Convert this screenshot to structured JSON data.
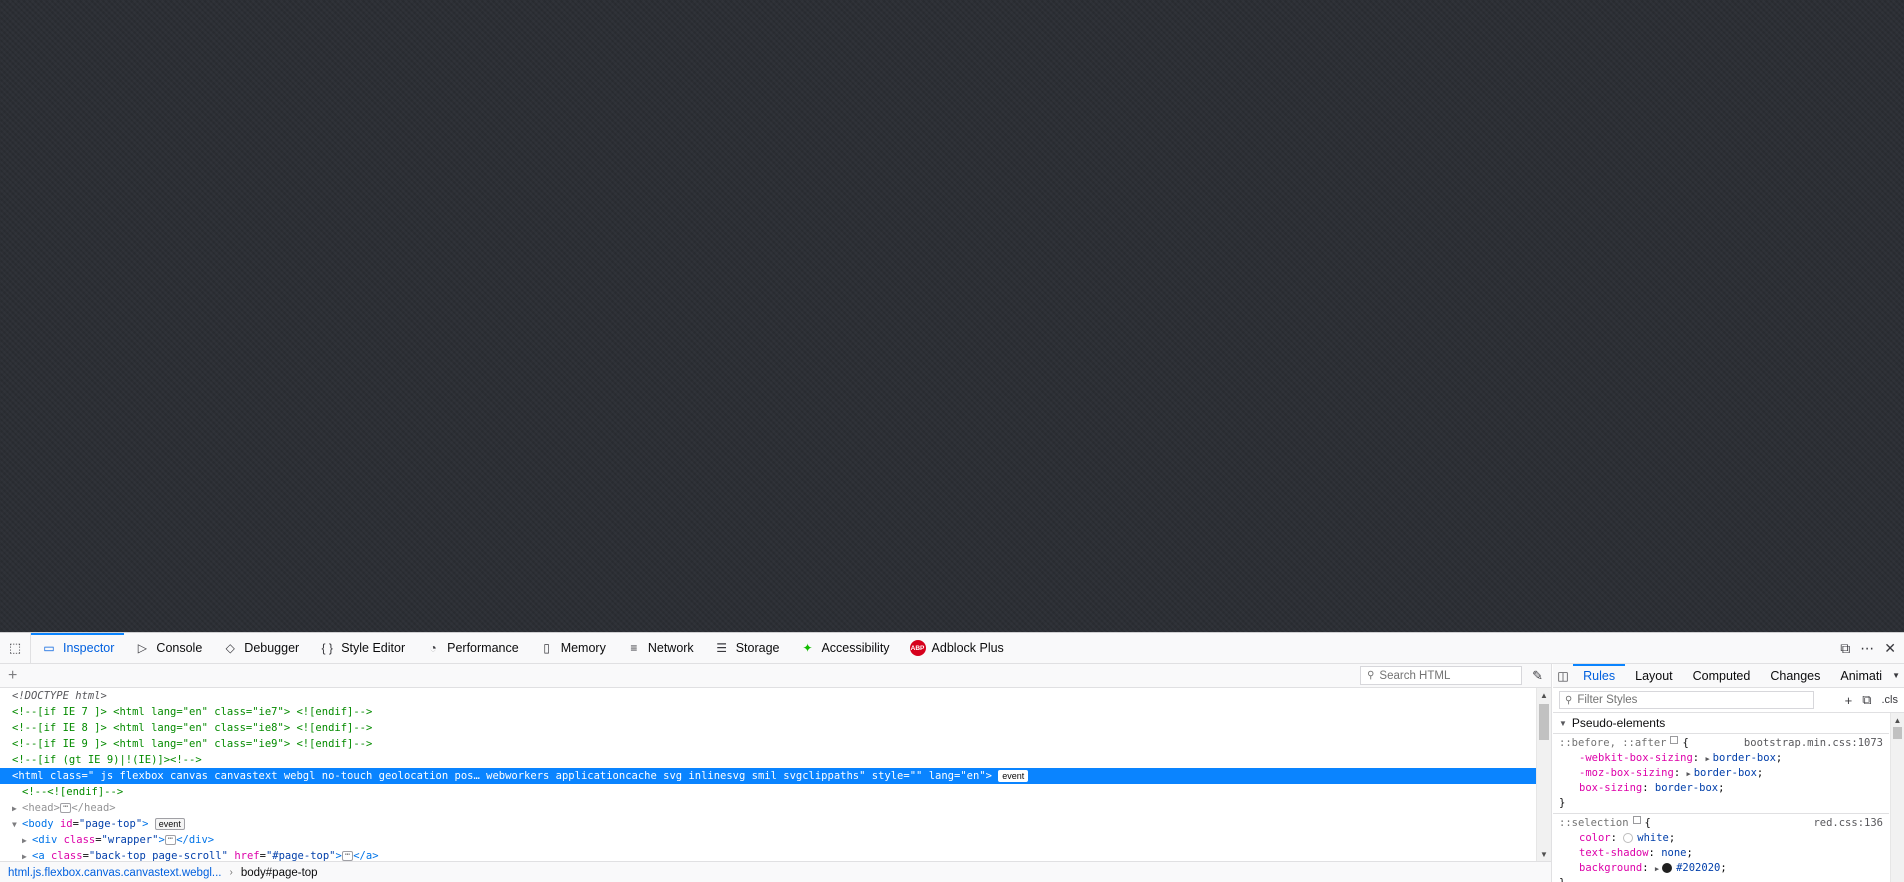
{
  "toolbar": {
    "tabs": [
      {
        "label": "Inspector",
        "icon": "inspector-icon"
      },
      {
        "label": "Console",
        "icon": "console-icon"
      },
      {
        "label": "Debugger",
        "icon": "debugger-icon"
      },
      {
        "label": "Style Editor",
        "icon": "braces-icon"
      },
      {
        "label": "Performance",
        "icon": "performance-icon"
      },
      {
        "label": "Memory",
        "icon": "memory-icon"
      },
      {
        "label": "Network",
        "icon": "network-icon"
      },
      {
        "label": "Storage",
        "icon": "storage-icon"
      },
      {
        "label": "Accessibility",
        "icon": "accessibility-icon"
      },
      {
        "label": "Adblock Plus",
        "icon": "abp-icon"
      }
    ],
    "abp_badge": "ABP"
  },
  "markup": {
    "search_placeholder": "Search HTML",
    "lines": {
      "doctype": "<!DOCTYPE html>",
      "ie7": "<!--[if IE 7 ]> <html lang=\"en\" class=\"ie7\"> <![endif]-->",
      "ie8": "<!--[if IE 8 ]> <html lang=\"en\" class=\"ie8\"> <![endif]-->",
      "ie9": "<!--[if IE 9 ]> <html lang=\"en\" class=\"ie9\"> <![endif]-->",
      "gtie9": "<!--[if (gt IE 9)|!(IE)]><!-->",
      "html_class_value": "\" js flexbox canvas canvastext webgl no-touch geolocation pos… webworkers applicationcache svg inlinesvg smil svgclippaths\"",
      "html_style_value": "\"\"",
      "html_lang_value": "\"en\"",
      "endif": "<!--<![endif]-->",
      "body_id_value": "\"page-top\"",
      "div_class_value": "\"wrapper\"",
      "a_class_value": "\"back-top page-scroll\"",
      "a_href_value": "\"#page-top\""
    },
    "event_badge": "event",
    "breadcrumbs": [
      "html.js.flexbox.canvas.canvastext.webgl...",
      "body#page-top"
    ]
  },
  "sidebar": {
    "tabs": [
      "Rules",
      "Layout",
      "Computed",
      "Changes",
      "Animati"
    ],
    "filter_placeholder": "Filter Styles",
    "cls_label": ".cls",
    "section_title": "Pseudo-elements",
    "rules": [
      {
        "selector": "::before, ::after",
        "source": "bootstrap.min.css:1073",
        "decls": [
          {
            "name": "-webkit-box-sizing",
            "value": "border-box",
            "twisty": true
          },
          {
            "name": "-moz-box-sizing",
            "value": "border-box",
            "twisty": true
          },
          {
            "name": "box-sizing",
            "value": "border-box",
            "twisty": false
          }
        ]
      },
      {
        "selector": "::selection",
        "source": "red.css:136",
        "decls": [
          {
            "name": "color",
            "value": "white",
            "swatch": "#ffffff"
          },
          {
            "name": "text-shadow",
            "value": "none"
          },
          {
            "name": "background",
            "value": "#202020",
            "swatch": "#202020",
            "twisty": true
          }
        ]
      }
    ]
  }
}
